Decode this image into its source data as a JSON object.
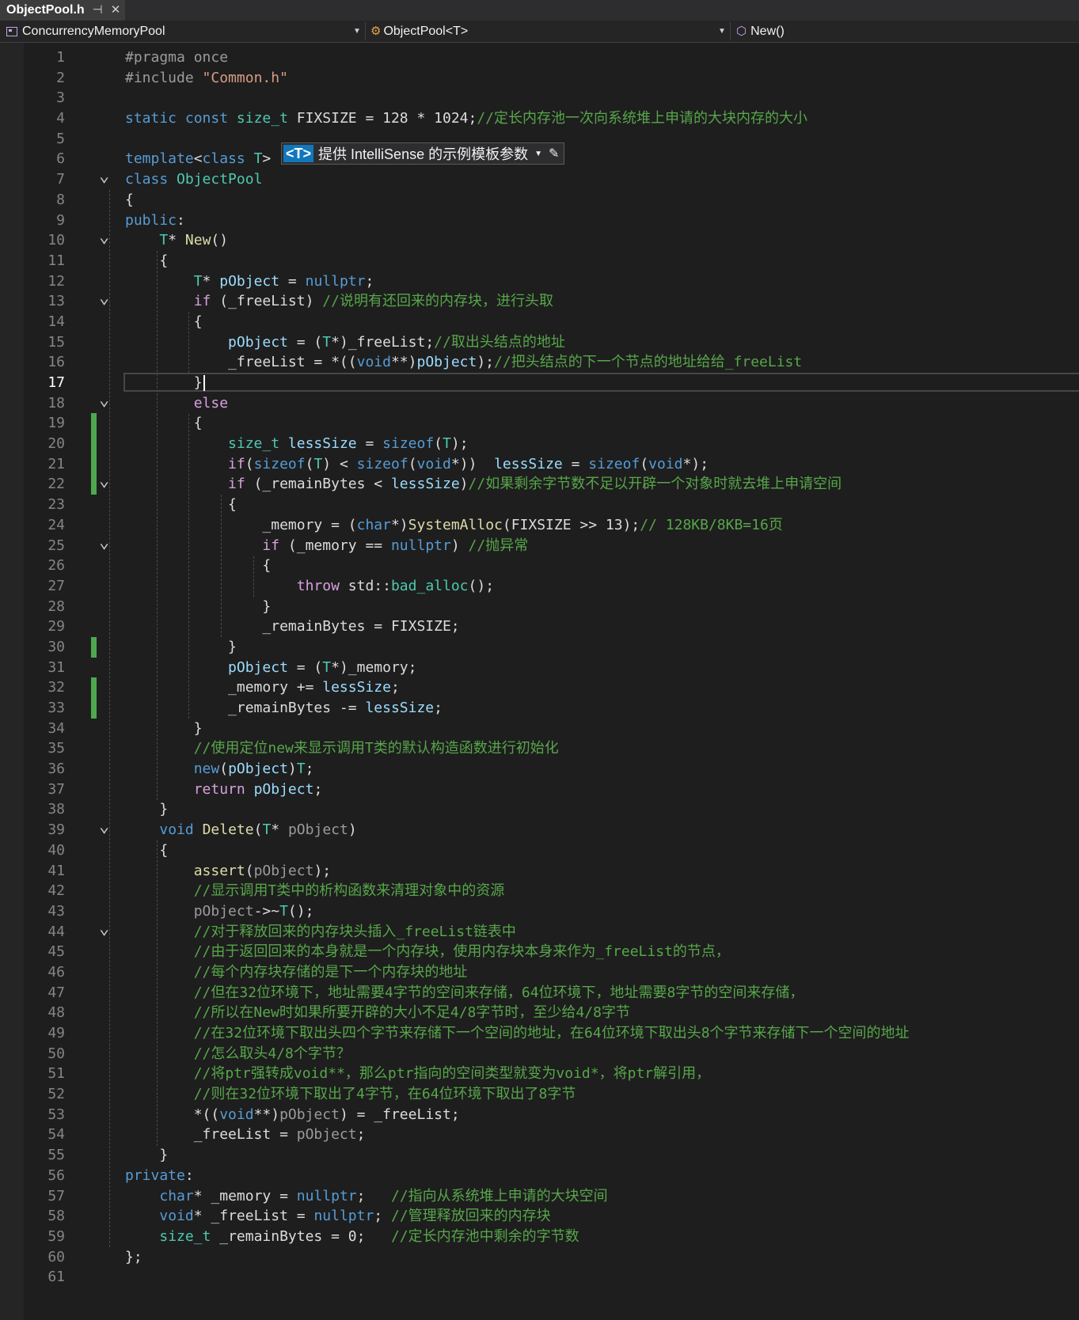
{
  "tab": {
    "title": "ObjectPool.h"
  },
  "nav": {
    "project": "ConcurrencyMemoryPool",
    "scope": "ObjectPool<T>",
    "member": "New()"
  },
  "hint": {
    "tag": "<T>",
    "label": "提供 IntelliSense 的示例模板参数"
  },
  "current_line": 17,
  "lines": [
    {
      "n": 1,
      "html": "<span class=\"pp\">#pragma once</span>"
    },
    {
      "n": 2,
      "html": "<span class=\"pp\">#include </span><span class=\"st\">\"Common.h\"</span>"
    },
    {
      "n": 3,
      "html": ""
    },
    {
      "n": 4,
      "html": "<span class=\"kw\">static const</span> <span class=\"ty\">size_t</span> FIXSIZE = 128 * 1024;<span class=\"cm\">//定长内存池一次向系统堆上申请的大块内存的大小</span>"
    },
    {
      "n": 5,
      "html": ""
    },
    {
      "n": 6,
      "html": "<span class=\"kw\">template</span>&lt;<span class=\"kw\">class</span> <span class=\"ty\">T</span>&gt;"
    },
    {
      "n": 7,
      "html": "<span class=\"kw\">class</span> <span class=\"ty\">ObjectPool</span>"
    },
    {
      "n": 8,
      "html": "{"
    },
    {
      "n": 9,
      "html": "<span class=\"kw\">public</span>:"
    },
    {
      "n": 10,
      "html": "    <span class=\"ty\">T</span>* <span class=\"fn\">New</span>()"
    },
    {
      "n": 11,
      "html": "    {"
    },
    {
      "n": 12,
      "html": "        <span class=\"ty\">T</span>* <span class=\"id\">pObject</span> = <span class=\"kw\">nullptr</span>;"
    },
    {
      "n": 13,
      "html": "        <span class=\"ctl\">if</span> (_freeList) <span class=\"cm\">//说明有还回来的内存块，进行头取</span>"
    },
    {
      "n": 14,
      "html": "        {"
    },
    {
      "n": 15,
      "html": "            <span class=\"id\">pObject</span> = (<span class=\"ty\">T</span>*)_freeList;<span class=\"cm\">//取出头结点的地址</span>"
    },
    {
      "n": 16,
      "html": "            _freeList = *((<span class=\"kw\">void</span>**)<span class=\"id\">pObject</span>);<span class=\"cm\">//把头结点的下一个节点的地址给给_freeList</span>"
    },
    {
      "n": 17,
      "html": "        }<span class=\"caret\"></span>"
    },
    {
      "n": 18,
      "html": "        <span class=\"ctl\">else</span>"
    },
    {
      "n": 19,
      "html": "        {"
    },
    {
      "n": 20,
      "html": "            <span class=\"ty\">size_t</span> <span class=\"id\">lessSize</span> = <span class=\"kw\">sizeof</span>(<span class=\"ty\">T</span>);"
    },
    {
      "n": 21,
      "html": "            <span class=\"ctl\">if</span>(<span class=\"kw\">sizeof</span>(<span class=\"ty\">T</span>) &lt; <span class=\"kw\">sizeof</span>(<span class=\"kw\">void</span>*))  <span class=\"id\">lessSize</span> = <span class=\"kw\">sizeof</span>(<span class=\"kw\">void</span>*);"
    },
    {
      "n": 22,
      "html": "            <span class=\"ctl\">if</span> (_remainBytes &lt; <span class=\"id\">lessSize</span>)<span class=\"cm\">//如果剩余字节数不足以开辟一个对象时就去堆上申请空间</span>"
    },
    {
      "n": 23,
      "html": "            {"
    },
    {
      "n": 24,
      "html": "                _memory = (<span class=\"kw\">char</span>*)<span class=\"fn\">SystemAlloc</span>(FIXSIZE &gt;&gt; 13);<span class=\"cm\">// 128KB/8KB=16页</span>"
    },
    {
      "n": 25,
      "html": "                <span class=\"ctl\">if</span> (_memory == <span class=\"kw\">nullptr</span>) <span class=\"cm\">//抛异常</span>"
    },
    {
      "n": 26,
      "html": "                {"
    },
    {
      "n": 27,
      "html": "                    <span class=\"ctl\">throw</span> std::<span class=\"ty\">bad_alloc</span>();"
    },
    {
      "n": 28,
      "html": "                }"
    },
    {
      "n": 29,
      "html": "                _remainBytes = FIXSIZE;"
    },
    {
      "n": 30,
      "html": "            }"
    },
    {
      "n": 31,
      "html": "            <span class=\"id\">pObject</span> = (<span class=\"ty\">T</span>*)_memory;"
    },
    {
      "n": 32,
      "html": "            _memory += <span class=\"id\">lessSize</span>;"
    },
    {
      "n": 33,
      "html": "            _remainBytes -= <span class=\"id\">lessSize</span>;"
    },
    {
      "n": 34,
      "html": "        }"
    },
    {
      "n": 35,
      "html": "        <span class=\"cm\">//使用定位new来显示调用T类的默认构造函数进行初始化</span>"
    },
    {
      "n": 36,
      "html": "        <span class=\"kw\">new</span>(<span class=\"id\">pObject</span>)<span class=\"ty\">T</span>;"
    },
    {
      "n": 37,
      "html": "        <span class=\"ctl\">return</span> <span class=\"id\">pObject</span>;"
    },
    {
      "n": 38,
      "html": "    }"
    },
    {
      "n": 39,
      "html": "    <span class=\"kw\">void</span> <span class=\"fn\">Delete</span>(<span class=\"ty\">T</span>* <span class=\"pp\">pObject</span>)"
    },
    {
      "n": 40,
      "html": "    {"
    },
    {
      "n": 41,
      "html": "        <span class=\"fn\">assert</span>(<span class=\"pp\">pObject</span>);"
    },
    {
      "n": 42,
      "html": "        <span class=\"cm\">//显示调用T类中的析构函数来清理对象中的资源</span>"
    },
    {
      "n": 43,
      "html": "        <span class=\"pp\">pObject</span>-&gt;~<span class=\"ty\">T</span>();"
    },
    {
      "n": 44,
      "html": "        <span class=\"cm\">//对于释放回来的内存块头插入_freeList链表中</span>"
    },
    {
      "n": 45,
      "html": "        <span class=\"cm\">//由于返回回来的本身就是一个内存块，使用内存块本身来作为_freeList的节点，</span>"
    },
    {
      "n": 46,
      "html": "        <span class=\"cm\">//每个内存块存储的是下一个内存块的地址</span>"
    },
    {
      "n": 47,
      "html": "        <span class=\"cm\">//但在32位环境下，地址需要4字节的空间来存储，64位环境下，地址需要8字节的空间来存储，</span>"
    },
    {
      "n": 48,
      "html": "        <span class=\"cm\">//所以在New时如果所要开辟的大小不足4/8字节时，至少给4/8字节</span>"
    },
    {
      "n": 49,
      "html": "        <span class=\"cm\">//在32位环境下取出头四个字节来存储下一个空间的地址，在64位环境下取出头8个字节来存储下一个空间的地址</span>"
    },
    {
      "n": 50,
      "html": "        <span class=\"cm\">//怎么取头4/8个字节？</span>"
    },
    {
      "n": 51,
      "html": "        <span class=\"cm\">//将ptr强转成void**，那么ptr指向的空间类型就变为void*，将ptr解引用，</span>"
    },
    {
      "n": 52,
      "html": "        <span class=\"cm\">//则在32位环境下取出了4字节，在64位环境下取出了8字节</span>"
    },
    {
      "n": 53,
      "html": "        *((<span class=\"kw\">void</span>**)<span class=\"pp\">pObject</span>) = _freeList;"
    },
    {
      "n": 54,
      "html": "        _freeList = <span class=\"pp\">pObject</span>;"
    },
    {
      "n": 55,
      "html": "    }"
    },
    {
      "n": 56,
      "html": "<span class=\"kw\">private</span>:"
    },
    {
      "n": 57,
      "html": "    <span class=\"kw\">char</span>* _memory = <span class=\"kw\">nullptr</span>;   <span class=\"cm\">//指向从系统堆上申请的大块空间</span>"
    },
    {
      "n": 58,
      "html": "    <span class=\"kw\">void</span>* _freeList = <span class=\"kw\">nullptr</span>; <span class=\"cm\">//管理释放回来的内存块</span>"
    },
    {
      "n": 59,
      "html": "    <span class=\"ty\">size_t</span> _remainBytes = 0;   <span class=\"cm\">//定长内存池中剩余的字节数</span>"
    },
    {
      "n": 60,
      "html": "};"
    },
    {
      "n": 61,
      "html": ""
    }
  ],
  "fold_lines": [
    7,
    10,
    13,
    18,
    22,
    25,
    39,
    44
  ],
  "changed_lines": [
    19,
    20,
    21,
    22,
    30,
    32,
    33
  ],
  "colors": {
    "background": "#1e1e1e",
    "keyword": "#569cd6",
    "comment": "#57a64a",
    "string": "#d69d85",
    "type": "#4ec9b0",
    "function": "#dcdcaa",
    "change_bar": "#4ea84e"
  },
  "icons": {
    "pin": "pin-icon",
    "close": "close-icon",
    "project": "project-icon",
    "class": "class-icon",
    "method": "method-icon",
    "dropdown": "chevron-down-icon",
    "edit": "pencil-icon",
    "fold": "chevron-down-icon"
  }
}
